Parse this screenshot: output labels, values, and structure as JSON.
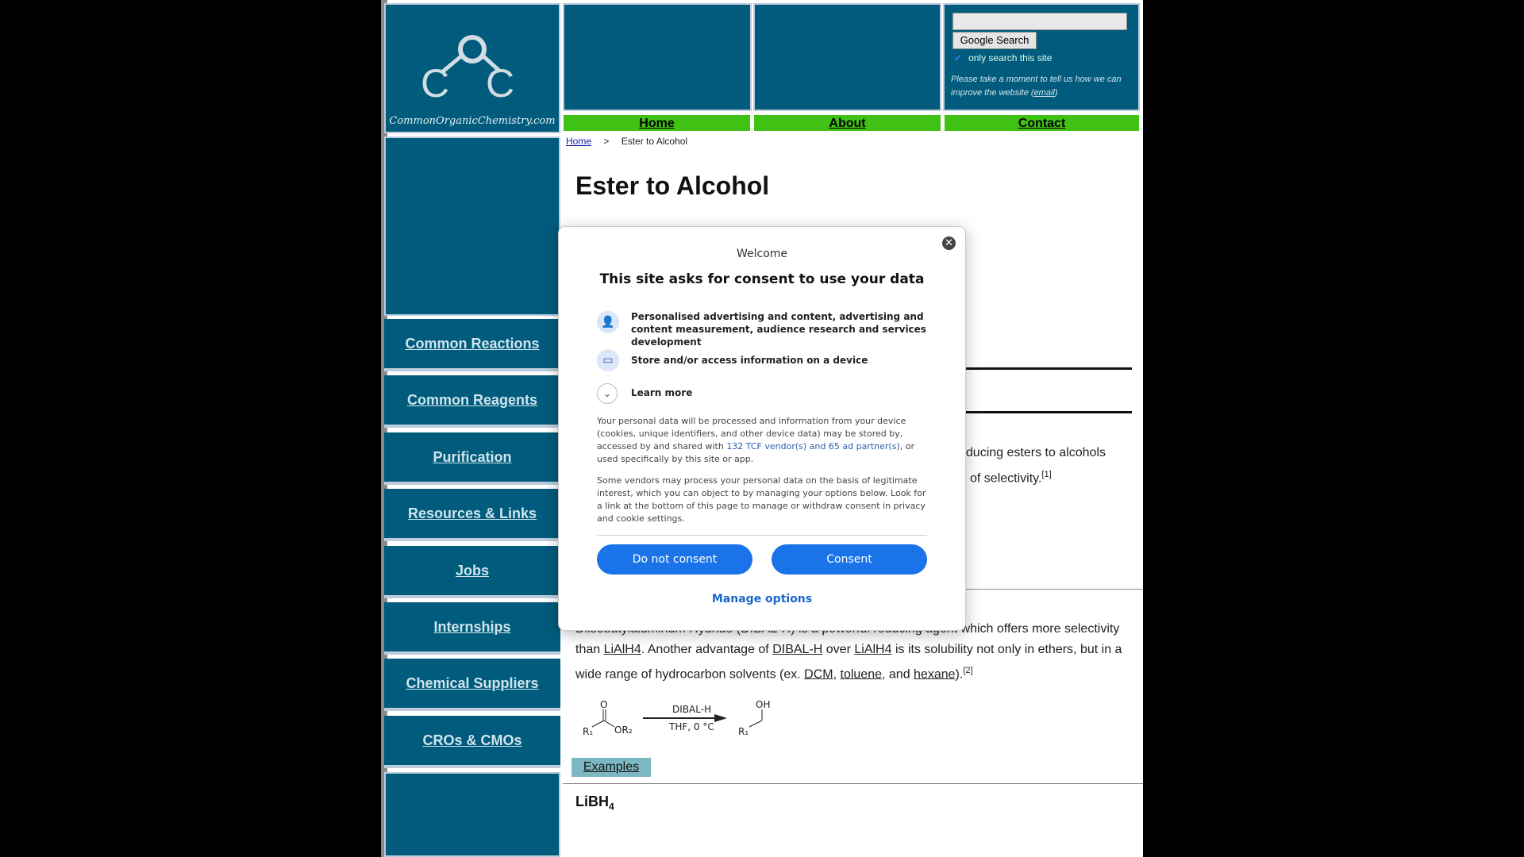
{
  "logo": {
    "site_name": "CommonOrganicChemistry.com"
  },
  "nav": {
    "home": "Home",
    "about": "About",
    "contact": "Contact"
  },
  "search": {
    "button": "Google Search",
    "only_site": "only search this site",
    "feedback": "Please take a moment to tell us how we can improve the website (",
    "feedback_link": "email",
    "feedback_end": ")"
  },
  "sidebar": {
    "items": [
      {
        "label": "Common Reactions"
      },
      {
        "label": "Common Reagents"
      },
      {
        "label": "Purification"
      },
      {
        "label": "Resources & Links"
      },
      {
        "label": "Jobs"
      },
      {
        "label": "Internships"
      },
      {
        "label": "Chemical Suppliers"
      },
      {
        "label": "CROs & CMOs"
      }
    ]
  },
  "breadcrumb": {
    "home": "Home",
    "sep": ">",
    "current": "Ester to Alcohol"
  },
  "page": {
    "title": "Ester to Alcohol"
  },
  "content": {
    "partial1": "educing esters to alcohols",
    "partial2": "of selectivity.",
    "ref1": "[1]",
    "dibal_line1": "Diisobutylaluminum Hydride (DIBAL-H) is a powerful reducing agent which offers more selectivity",
    "dibal_than": "than",
    "lialh4": "LiAlH4",
    "another": ". Another advantage of",
    "dibal": "DIBAL-H",
    "over": "over",
    "solubility": "is its solubility not only in ethers, but in a",
    "wide": "wide range of hydrocarbon solvents (ex.",
    "dcm": "DCM",
    "toluene": "toluene",
    "and": ", and",
    "hexane": "hexane",
    "close": ").",
    "ref2": "[2]",
    "scheme_reagent": "DIBAL-H",
    "scheme_cond": "THF, 0 °C",
    "examples": "Examples",
    "next_heading": "LiBH",
    "next_sub": "4"
  },
  "modal": {
    "welcome": "Welcome",
    "title": "This site asks for consent to use your data",
    "purpose1": "Personalised advertising and content, advertising and content measurement, audience research and services development",
    "purpose2": "Store and/or access information on a device",
    "learn_more": "Learn more",
    "text1a": "Your personal data will be processed and information from your device (cookies, unique identifiers, and other device data) may be stored by, accessed by and shared with",
    "vendors": "132 TCF vendor(s) and 65 ad partner(s)",
    "text1b": ", or used specifically by this site or app.",
    "text2": "Some vendors may process your personal data on the basis of legitimate interest, which you can object to by managing your options below. Look for a link at the bottom of this page to manage or withdraw consent in privacy and cookie settings.",
    "do_not_consent": "Do not consent",
    "consent": "Consent",
    "manage": "Manage options"
  }
}
